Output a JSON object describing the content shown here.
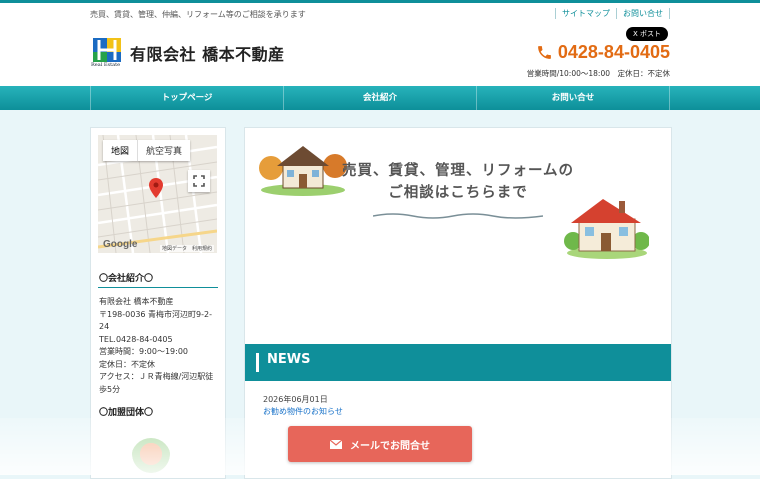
{
  "header": {
    "tagline": "売買、賃貸、管理、仲編、リフォーム等のご相談を承ります",
    "links": [
      "サイトマップ",
      "お問い合せ"
    ],
    "logo_sub": "Real Estate",
    "title": "有限会社 橋本不動産",
    "xpost": "X ポスト",
    "phone": "0428-84-0405",
    "hours": "営業時間/10:00～18:00　定休日：不定休"
  },
  "nav": [
    "トップページ",
    "会社紹介",
    "お問い合せ"
  ],
  "map": {
    "tab_map": "地図",
    "tab_aerial": "航空写真",
    "google": "Google",
    "attribution": "地図データ　利用規約"
  },
  "sidebar": {
    "company_heading": "〇会社紹介〇",
    "company_lines": [
      "有限会社 橋本不動産",
      "〒198-0036 青梅市河辺町9-2-24",
      "TEL.0428-84-0405",
      "営業時間：9:00～19:00",
      "定休日：不定休",
      "アクセス：ＪＲ青梅線/河辺駅徒歩5分"
    ],
    "assoc_heading": "〇加盟団体〇"
  },
  "hero": {
    "line1": "売買、賃貸、管理、リフォームの",
    "line2": "ご相談はこちらまで"
  },
  "news": {
    "title": "NEWS",
    "date": "2026年06月01日",
    "item": "お勧め物件のお知らせ"
  },
  "mail_button": "メールでお問合せ",
  "colors": {
    "teal": "#0f8f9a",
    "orange": "#e26b13",
    "coral": "#e7665a"
  }
}
